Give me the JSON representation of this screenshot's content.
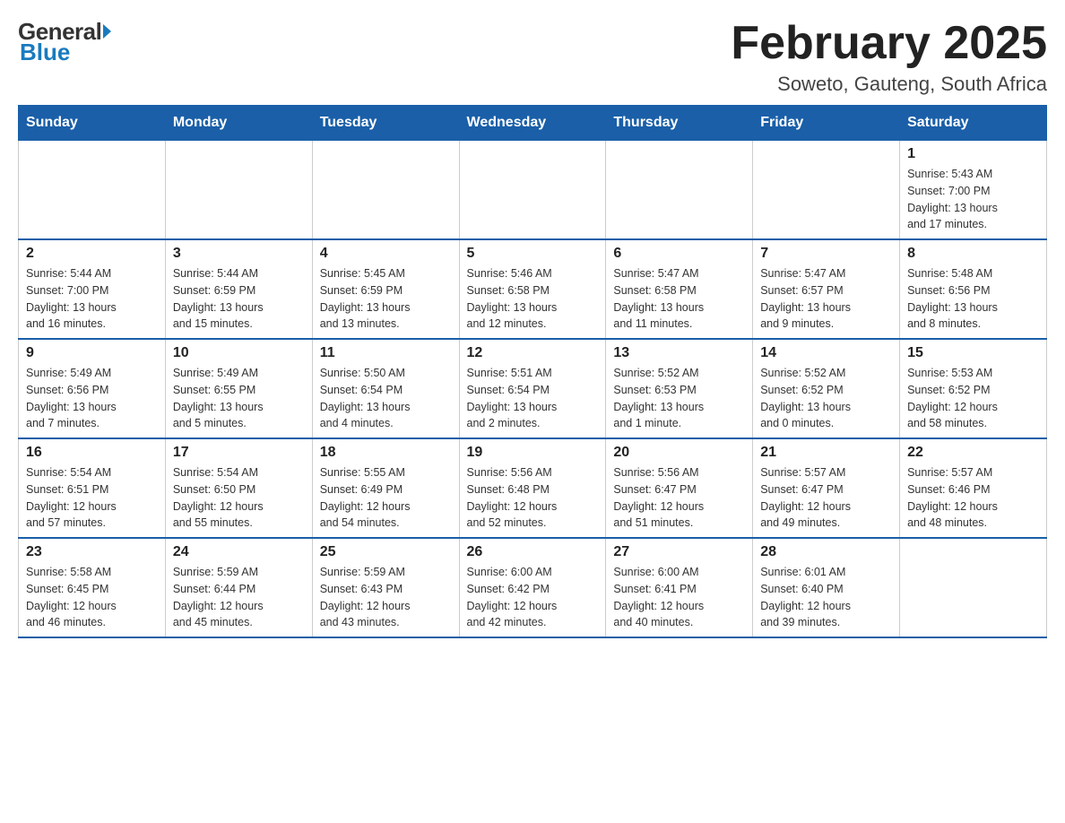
{
  "header": {
    "logo_general": "General",
    "logo_blue": "Blue",
    "month_title": "February 2025",
    "location": "Soweto, Gauteng, South Africa"
  },
  "days_of_week": [
    "Sunday",
    "Monday",
    "Tuesday",
    "Wednesday",
    "Thursday",
    "Friday",
    "Saturday"
  ],
  "weeks": [
    [
      {
        "day": "",
        "info": ""
      },
      {
        "day": "",
        "info": ""
      },
      {
        "day": "",
        "info": ""
      },
      {
        "day": "",
        "info": ""
      },
      {
        "day": "",
        "info": ""
      },
      {
        "day": "",
        "info": ""
      },
      {
        "day": "1",
        "info": "Sunrise: 5:43 AM\nSunset: 7:00 PM\nDaylight: 13 hours\nand 17 minutes."
      }
    ],
    [
      {
        "day": "2",
        "info": "Sunrise: 5:44 AM\nSunset: 7:00 PM\nDaylight: 13 hours\nand 16 minutes."
      },
      {
        "day": "3",
        "info": "Sunrise: 5:44 AM\nSunset: 6:59 PM\nDaylight: 13 hours\nand 15 minutes."
      },
      {
        "day": "4",
        "info": "Sunrise: 5:45 AM\nSunset: 6:59 PM\nDaylight: 13 hours\nand 13 minutes."
      },
      {
        "day": "5",
        "info": "Sunrise: 5:46 AM\nSunset: 6:58 PM\nDaylight: 13 hours\nand 12 minutes."
      },
      {
        "day": "6",
        "info": "Sunrise: 5:47 AM\nSunset: 6:58 PM\nDaylight: 13 hours\nand 11 minutes."
      },
      {
        "day": "7",
        "info": "Sunrise: 5:47 AM\nSunset: 6:57 PM\nDaylight: 13 hours\nand 9 minutes."
      },
      {
        "day": "8",
        "info": "Sunrise: 5:48 AM\nSunset: 6:56 PM\nDaylight: 13 hours\nand 8 minutes."
      }
    ],
    [
      {
        "day": "9",
        "info": "Sunrise: 5:49 AM\nSunset: 6:56 PM\nDaylight: 13 hours\nand 7 minutes."
      },
      {
        "day": "10",
        "info": "Sunrise: 5:49 AM\nSunset: 6:55 PM\nDaylight: 13 hours\nand 5 minutes."
      },
      {
        "day": "11",
        "info": "Sunrise: 5:50 AM\nSunset: 6:54 PM\nDaylight: 13 hours\nand 4 minutes."
      },
      {
        "day": "12",
        "info": "Sunrise: 5:51 AM\nSunset: 6:54 PM\nDaylight: 13 hours\nand 2 minutes."
      },
      {
        "day": "13",
        "info": "Sunrise: 5:52 AM\nSunset: 6:53 PM\nDaylight: 13 hours\nand 1 minute."
      },
      {
        "day": "14",
        "info": "Sunrise: 5:52 AM\nSunset: 6:52 PM\nDaylight: 13 hours\nand 0 minutes."
      },
      {
        "day": "15",
        "info": "Sunrise: 5:53 AM\nSunset: 6:52 PM\nDaylight: 12 hours\nand 58 minutes."
      }
    ],
    [
      {
        "day": "16",
        "info": "Sunrise: 5:54 AM\nSunset: 6:51 PM\nDaylight: 12 hours\nand 57 minutes."
      },
      {
        "day": "17",
        "info": "Sunrise: 5:54 AM\nSunset: 6:50 PM\nDaylight: 12 hours\nand 55 minutes."
      },
      {
        "day": "18",
        "info": "Sunrise: 5:55 AM\nSunset: 6:49 PM\nDaylight: 12 hours\nand 54 minutes."
      },
      {
        "day": "19",
        "info": "Sunrise: 5:56 AM\nSunset: 6:48 PM\nDaylight: 12 hours\nand 52 minutes."
      },
      {
        "day": "20",
        "info": "Sunrise: 5:56 AM\nSunset: 6:47 PM\nDaylight: 12 hours\nand 51 minutes."
      },
      {
        "day": "21",
        "info": "Sunrise: 5:57 AM\nSunset: 6:47 PM\nDaylight: 12 hours\nand 49 minutes."
      },
      {
        "day": "22",
        "info": "Sunrise: 5:57 AM\nSunset: 6:46 PM\nDaylight: 12 hours\nand 48 minutes."
      }
    ],
    [
      {
        "day": "23",
        "info": "Sunrise: 5:58 AM\nSunset: 6:45 PM\nDaylight: 12 hours\nand 46 minutes."
      },
      {
        "day": "24",
        "info": "Sunrise: 5:59 AM\nSunset: 6:44 PM\nDaylight: 12 hours\nand 45 minutes."
      },
      {
        "day": "25",
        "info": "Sunrise: 5:59 AM\nSunset: 6:43 PM\nDaylight: 12 hours\nand 43 minutes."
      },
      {
        "day": "26",
        "info": "Sunrise: 6:00 AM\nSunset: 6:42 PM\nDaylight: 12 hours\nand 42 minutes."
      },
      {
        "day": "27",
        "info": "Sunrise: 6:00 AM\nSunset: 6:41 PM\nDaylight: 12 hours\nand 40 minutes."
      },
      {
        "day": "28",
        "info": "Sunrise: 6:01 AM\nSunset: 6:40 PM\nDaylight: 12 hours\nand 39 minutes."
      },
      {
        "day": "",
        "info": ""
      }
    ]
  ]
}
